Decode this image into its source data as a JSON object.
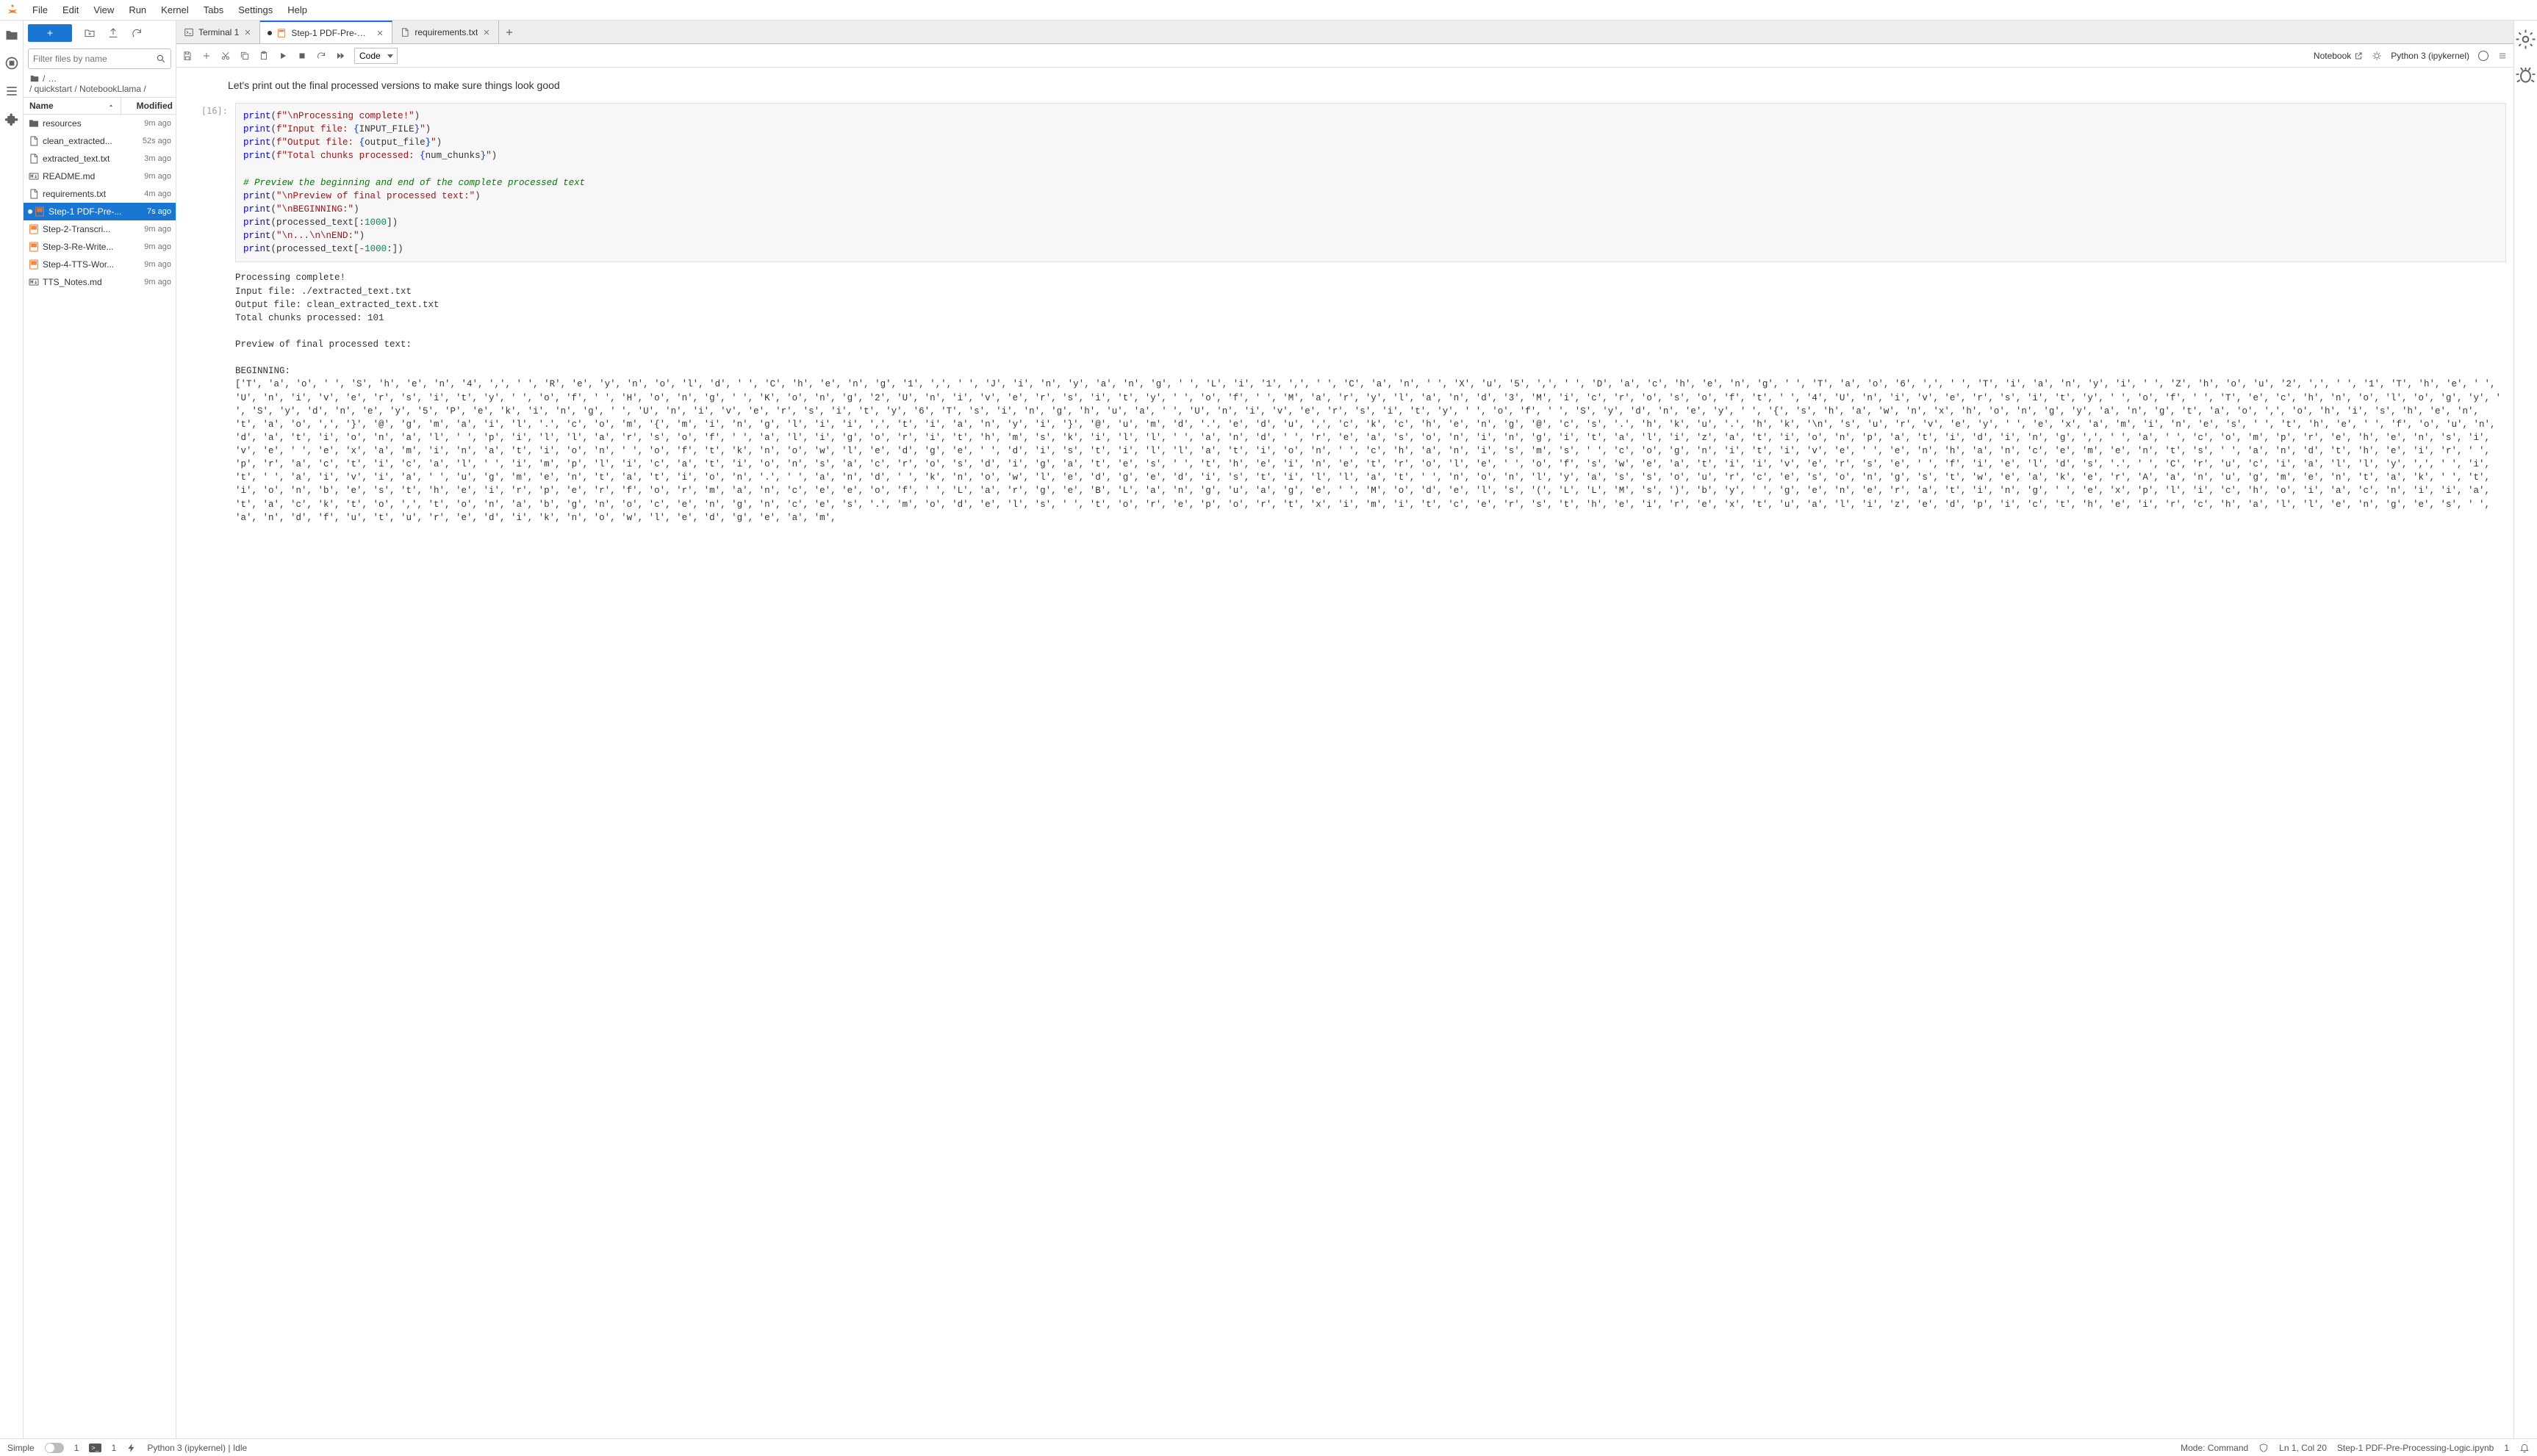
{
  "menu": {
    "items": [
      "File",
      "Edit",
      "View",
      "Run",
      "Kernel",
      "Tabs",
      "Settings",
      "Help"
    ]
  },
  "sidebar": {
    "filter_placeholder": "Filter files by name",
    "breadcrumb_path": "/ quickstart / NotebookLlama /",
    "header_name": "Name",
    "header_modified": "Modified",
    "files": [
      {
        "icon": "folder",
        "name": "resources",
        "modified": "9m ago",
        "selected": false,
        "dirty": false
      },
      {
        "icon": "file",
        "name": "clean_extracted...",
        "modified": "52s ago",
        "selected": false,
        "dirty": false
      },
      {
        "icon": "file",
        "name": "extracted_text.txt",
        "modified": "3m ago",
        "selected": false,
        "dirty": false
      },
      {
        "icon": "markdown",
        "name": "README.md",
        "modified": "9m ago",
        "selected": false,
        "dirty": false
      },
      {
        "icon": "file",
        "name": "requirements.txt",
        "modified": "4m ago",
        "selected": false,
        "dirty": false
      },
      {
        "icon": "notebook",
        "name": "Step-1 PDF-Pre-...",
        "modified": "7s ago",
        "selected": true,
        "dirty": true
      },
      {
        "icon": "notebook",
        "name": "Step-2-Transcri...",
        "modified": "9m ago",
        "selected": false,
        "dirty": false
      },
      {
        "icon": "notebook",
        "name": "Step-3-Re-Write...",
        "modified": "9m ago",
        "selected": false,
        "dirty": false
      },
      {
        "icon": "notebook",
        "name": "Step-4-TTS-Wor...",
        "modified": "9m ago",
        "selected": false,
        "dirty": false
      },
      {
        "icon": "markdown",
        "name": "TTS_Notes.md",
        "modified": "9m ago",
        "selected": false,
        "dirty": false
      }
    ]
  },
  "tabs": [
    {
      "icon": "terminal",
      "label": "Terminal 1",
      "active": false
    },
    {
      "icon": "notebook",
      "label": "Step-1 PDF-Pre-Processing",
      "active": true,
      "dirty": true
    },
    {
      "icon": "file",
      "label": "requirements.txt",
      "active": false
    }
  ],
  "nb_toolbar": {
    "cell_type": "Code",
    "trusted": "Notebook",
    "kernel": "Python 3 (ipykernel)"
  },
  "notebook": {
    "markdown": "Let's print out the final processed versions to make sure things look good",
    "prompt": "[16]:",
    "output": "Processing complete!\nInput file: ./extracted_text.txt\nOutput file: clean_extracted_text.txt\nTotal chunks processed: 101\n\nPreview of final processed text:\n\nBEGINNING:\n['T', 'a', 'o', ' ', 'S', 'h', 'e', 'n', '4', ',', ' ', 'R', 'e', 'y', 'n', 'o', 'l', 'd', ' ', 'C', 'h', 'e', 'n', 'g', '1', ',', ' ', 'J', 'i', 'n', 'y', 'a', 'n', 'g', ' ', 'L', 'i', '1', ',', ' ', 'C', 'a', 'n', ' ', 'X', 'u', '5', ',', ' ', 'D', 'a', 'c', 'h', 'e', 'n', 'g', ' ', 'T', 'a', 'o', '6', ',', ' ', 'T', 'i', 'a', 'n', 'y', 'i', ' ', 'Z', 'h', 'o', 'u', '2', ',', ' ', '1', 'T', 'h', 'e', ' ', 'U', 'n', 'i', 'v', 'e', 'r', 's', 'i', 't', 'y', ' ', 'o', 'f', ' ', 'H', 'o', 'n', 'g', ' ', 'K', 'o', 'n', 'g', '2', 'U', 'n', 'i', 'v', 'e', 'r', 's', 'i', 't', 'y', ' ', 'o', 'f', ' ', 'M', 'a', 'r', 'y', 'l', 'a', 'n', 'd', '3', 'M', 'i', 'c', 'r', 'o', 's', 'o', 'f', 't', ' ', '4', 'U', 'n', 'i', 'v', 'e', 'r', 's', 'i', 't', 'y', ' ', 'o', 'f', ' ', 'T', 'e', 'c', 'h', 'n', 'o', 'l', 'o', 'g', 'y', ' ', 'S', 'y', 'd', 'n', 'e', 'y', '5', 'P', 'e', 'k', 'i', 'n', 'g', ' ', 'U', 'n', 'i', 'v', 'e', 'r', 's', 'i', 't', 'y', '6', 'T', 's', 'i', 'n', 'g', 'h', 'u', 'a', ' ', 'U', 'n', 'i', 'v', 'e', 'r', 's', 'i', 't', 'y', ' ', 'o', 'f', ' ', 'S', 'y', 'd', 'n', 'e', 'y', ' ', '{', 's', 'h', 'a', 'w', 'n', 'x', 'h', 'o', 'n', 'g', 'y', 'a', 'n', 'g', 't', 'a', 'o', ',', 'o', 'h', 'i', 's', 'h', 'e', 'n', 't', 'a', 'o', ',', '}', '@', 'g', 'm', 'a', 'i', 'l', '.', 'c', 'o', 'm', '{', 'm', 'i', 'n', 'g', 'l', 'i', 'i', ',', 't', 'i', 'a', 'n', 'y', 'i', '}', '@', 'u', 'm', 'd', '.', 'e', 'd', 'u', ',', 'c', 'k', 'c', 'h', 'e', 'n', 'g', '@', 'c', 's', '.', 'h', 'k', 'u', '.', 'h', 'k', '\\n', 's', 'u', 'r', 'v', 'e', 'y', ' ', 'e', 'x', 'a', 'm', 'i', 'n', 'e', 's', ' ', 't', 'h', 'e', ' ', 'f', 'o', 'u', 'n', 'd', 'a', 't', 'i', 'o', 'n', 'a', 'l', ' ', 'p', 'i', 'l', 'l', 'a', 'r', 's', 'o', 'f', ' ', 'a', 'l', 'i', 'g', 'o', 'r', 'i', 't', 'h', 'm', 's', 'k', 'i', 'l', 'l', ' ', 'a', 'n', 'd', ' ', 'r', 'e', 'a', 's', 'o', 'n', 'i', 'n', 'g', 'i', 't', 'a', 'l', 'i', 'z', 'a', 't', 'i', 'o', 'n', 'p', 'a', 't', 'i', 'd', 'i', 'n', 'g', ',', ' ', 'a', ' ', 'c', 'o', 'm', 'p', 'r', 'e', 'h', 'e', 'n', 's', 'i', 'v', 'e', ' ', 'e', 'x', 'a', 'm', 'i', 'n', 'a', 't', 'i', 'o', 'n', ' ', 'o', 'f', 't', 'k', 'n', 'o', 'w', 'l', 'e', 'd', 'g', 'e', ' ', 'd', 'i', 's', 't', 'i', 'l', 'l', 'a', 't', 'i', 'o', 'n', ' ', 'c', 'h', 'a', 'n', 'i', 's', 'm', 's', ' ', 'c', 'o', 'g', 'n', 'i', 't', 'i', 'v', 'e', ' ', 'e', 'n', 'h', 'a', 'n', 'c', 'e', 'm', 'e', 'n', 't', 's', ' ', 'a', 'n', 'd', 't', 'h', 'e', 'i', 'r', ' ', 'p', 'r', 'a', 'c', 't', 'i', 'c', 'a', 'l', ' ', 'i', 'm', 'p', 'l', 'i', 'c', 'a', 't', 'i', 'o', 'n', 's', 'a', 'c', 'r', 'o', 's', 'd', 'i', 'g', 'a', 't', 'e', 's', ' ', 't', 'h', 'e', 'i', 'n', 'e', 't', 'r', 'o', 'l', 'e', ' ', 'o', 'f', 's', 'w', 'e', 'a', 't', 'i', 'i', 'v', 'e', 'r', 's', 'e', ' ', 'f', 'i', 'e', 'l', 'd', 's', '.', ' ', 'C', 'r', 'u', 'c', 'i', 'a', 'l', 'l', 'y', ',', ' ', 'i', 't', ' ', 'a', 'i', 'v', 'i', 'a', ' ', 'u', 'g', 'm', 'e', 'n', 't', 'a', 't', 'i', 'o', 'n', '.', ' ', 'a', 'n', 'd', ' ', 'k', 'n', 'o', 'w', 'l', 'e', 'd', 'g', 'e', 'd', 'i', 's', 't', 'i', 'l', 'l', 'a', 't', ' ', 'n', 'o', 'n', 'l', 'y', 'a', 's', 's', 'o', 'u', 'r', 'c', 'e', 's', 'o', 'n', 'g', 's', 't', 'w', 'e', 'a', 'k', 'e', 'r', 'A', 'a', 'n', 'u', 'g', 'm', 'e', 'n', 't', 'a', 'k', ' ', 't', 'i', 'o', 'n', 'b', 'e', 's', 't', 'h', 'e', 'i', 'r', 'p', 'e', 'r', 'f', 'o', 'r', 'm', 'a', 'n', 'c', 'e', 'e', 'o', 'f', ' ', 'L', 'a', 'r', 'g', 'e', 'B', 'L', 'a', 'n', 'g', 'u', 'a', 'g', 'e', ' ', 'M', 'o', 'd', 'e', 'l', 's', '(', 'L', 'L', 'M', 's', ')', 'b', 'y', ' ', 'g', 'e', 'n', 'e', 'r', 'a', 't', 'i', 'n', 'g', ' ', 'e', 'x', 'p', 'l', 'i', 'c', 'h', 'o', 'i', 'a', 'c', 'n', 'i', 'i', 'a', 't', 'a', 'c', 'k', 't', 'o', ',', 't', 'o', 'n', 'a', 'b', 'g', 'n', 'o', 'c', 'e', 'n', 'g', 'n', 'c', 'e', 's', '.', 'm', 'o', 'd', 'e', 'l', 's', ' ', 't', 'o', 'r', 'e', 'p', 'o', 'r', 't', 'x', 'i', 'm', 'i', 't', 'c', 'e', 'r', 's', 't', 'h', 'e', 'i', 'r', 'e', 'x', 't', 'u', 'a', 'l', 'i', 'z', 'e', 'd', 'p', 'i', 'c', 't', 'h', 'e', 'i', 'r', 'c', 'h', 'a', 'l', 'l', 'e', 'n', 'g', 'e', 's', ' ', 'a', 'n', 'd', 'f', 'u', 't', 'u', 'r', 'e', 'd', 'i', 'k', 'n', 'o', 'w', 'l', 'e', 'd', 'g', 'e', 'a', 'm', "
  },
  "statusbar": {
    "simple": "Simple",
    "count1": "1",
    "term_count": "1",
    "kernel": "Python 3 (ipykernel) | Idle",
    "mode": "Mode: Command",
    "cursor": "Ln 1, Col 20",
    "file": "Step-1 PDF-Pre-Processing-Logic.ipynb",
    "right_count": "1"
  }
}
